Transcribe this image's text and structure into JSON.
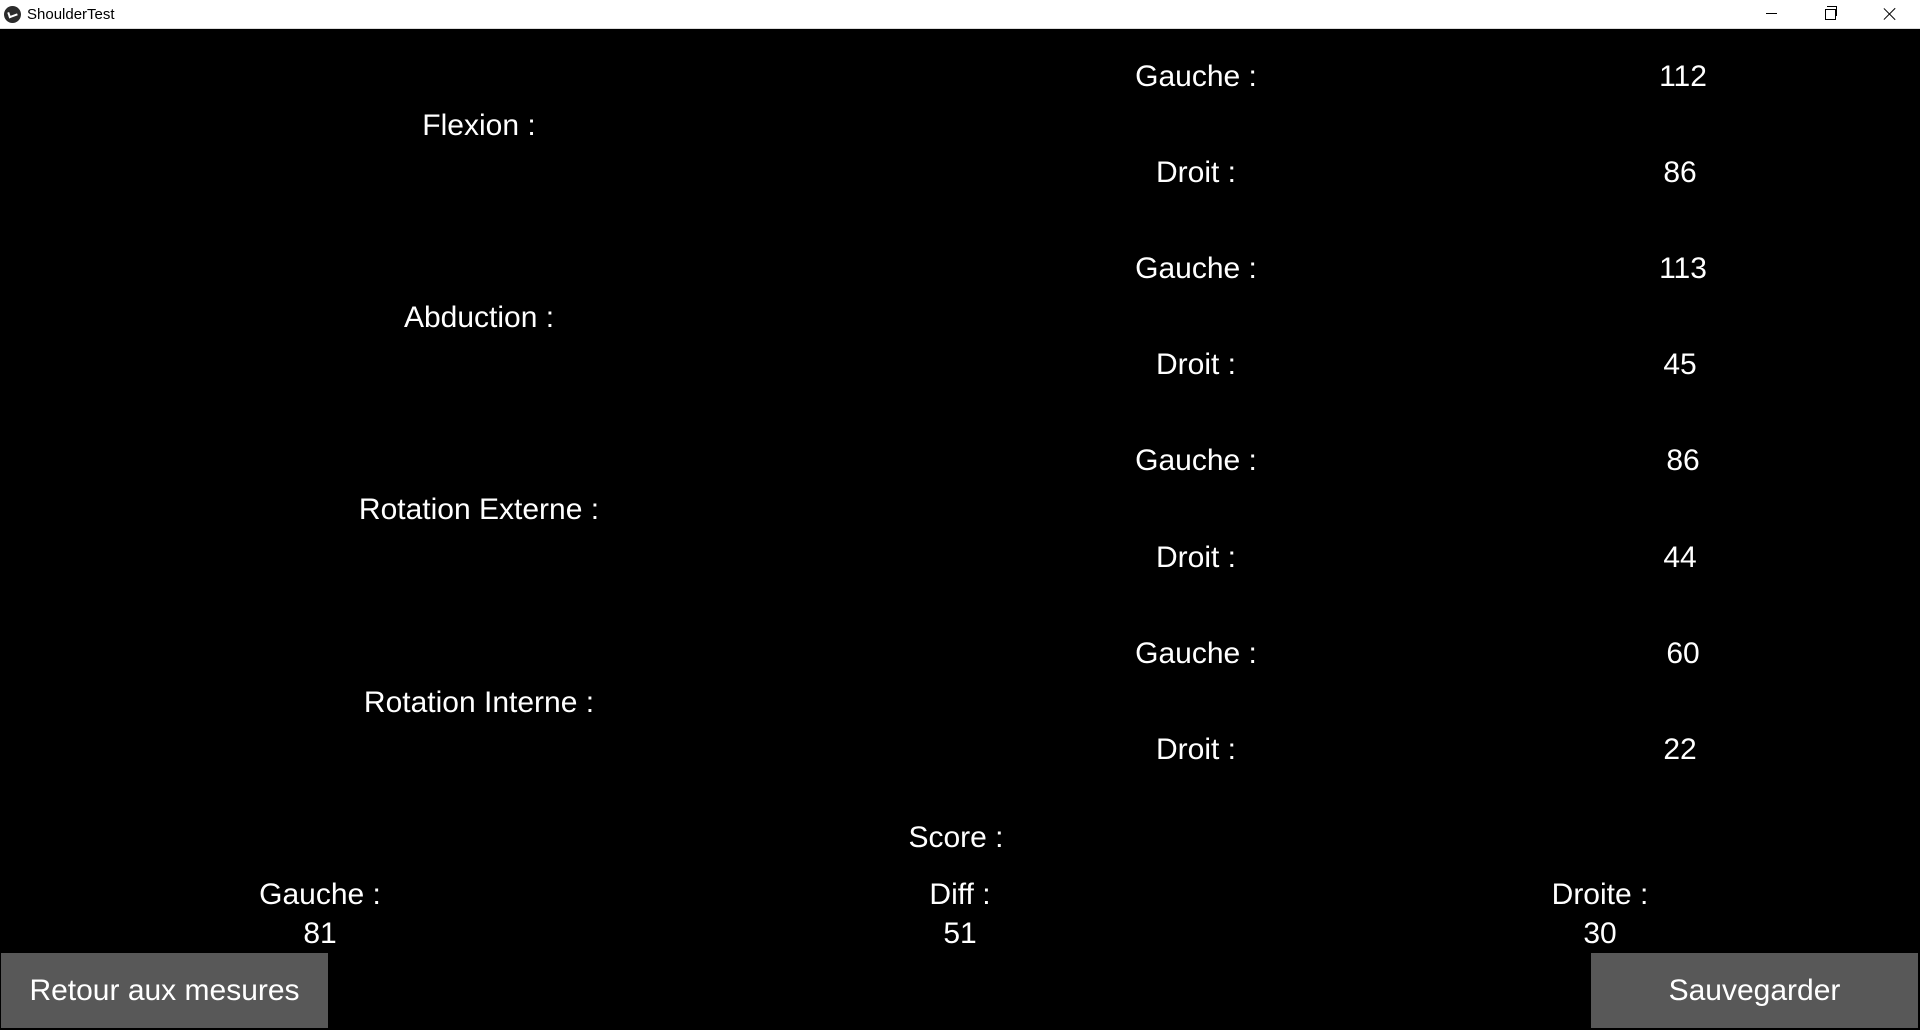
{
  "window": {
    "title": "ShoulderTest",
    "icon": "app-logo-icon",
    "controls": [
      "minimize-icon",
      "restore-icon",
      "close-icon"
    ]
  },
  "measures": [
    {
      "name": "Flexion :",
      "left_label": "Gauche :",
      "left_value": "112",
      "right_label": "Droit :",
      "right_value": "86"
    },
    {
      "name": "Abduction :",
      "left_label": "Gauche :",
      "left_value": "113",
      "right_label": "Droit :",
      "right_value": "45"
    },
    {
      "name": "Rotation Externe :",
      "left_label": "Gauche :",
      "left_value": "86",
      "right_label": "Droit :",
      "right_value": "44"
    },
    {
      "name": "Rotation Interne :",
      "left_label": "Gauche :",
      "left_value": "60",
      "right_label": "Droit :",
      "right_value": "22"
    }
  ],
  "score": {
    "title": "Score :",
    "gauche_label": "Gauche :",
    "gauche_value": "81",
    "diff_label": "Diff :",
    "diff_value": "51",
    "droite_label": "Droite :",
    "droite_value": "30"
  },
  "buttons": {
    "back_label": "Retour aux mesures",
    "save_label": "Sauvegarder"
  },
  "colors": {
    "background": "#000000",
    "text": "#ffffff",
    "button": "#585858",
    "titlebar": "#ffffff"
  }
}
